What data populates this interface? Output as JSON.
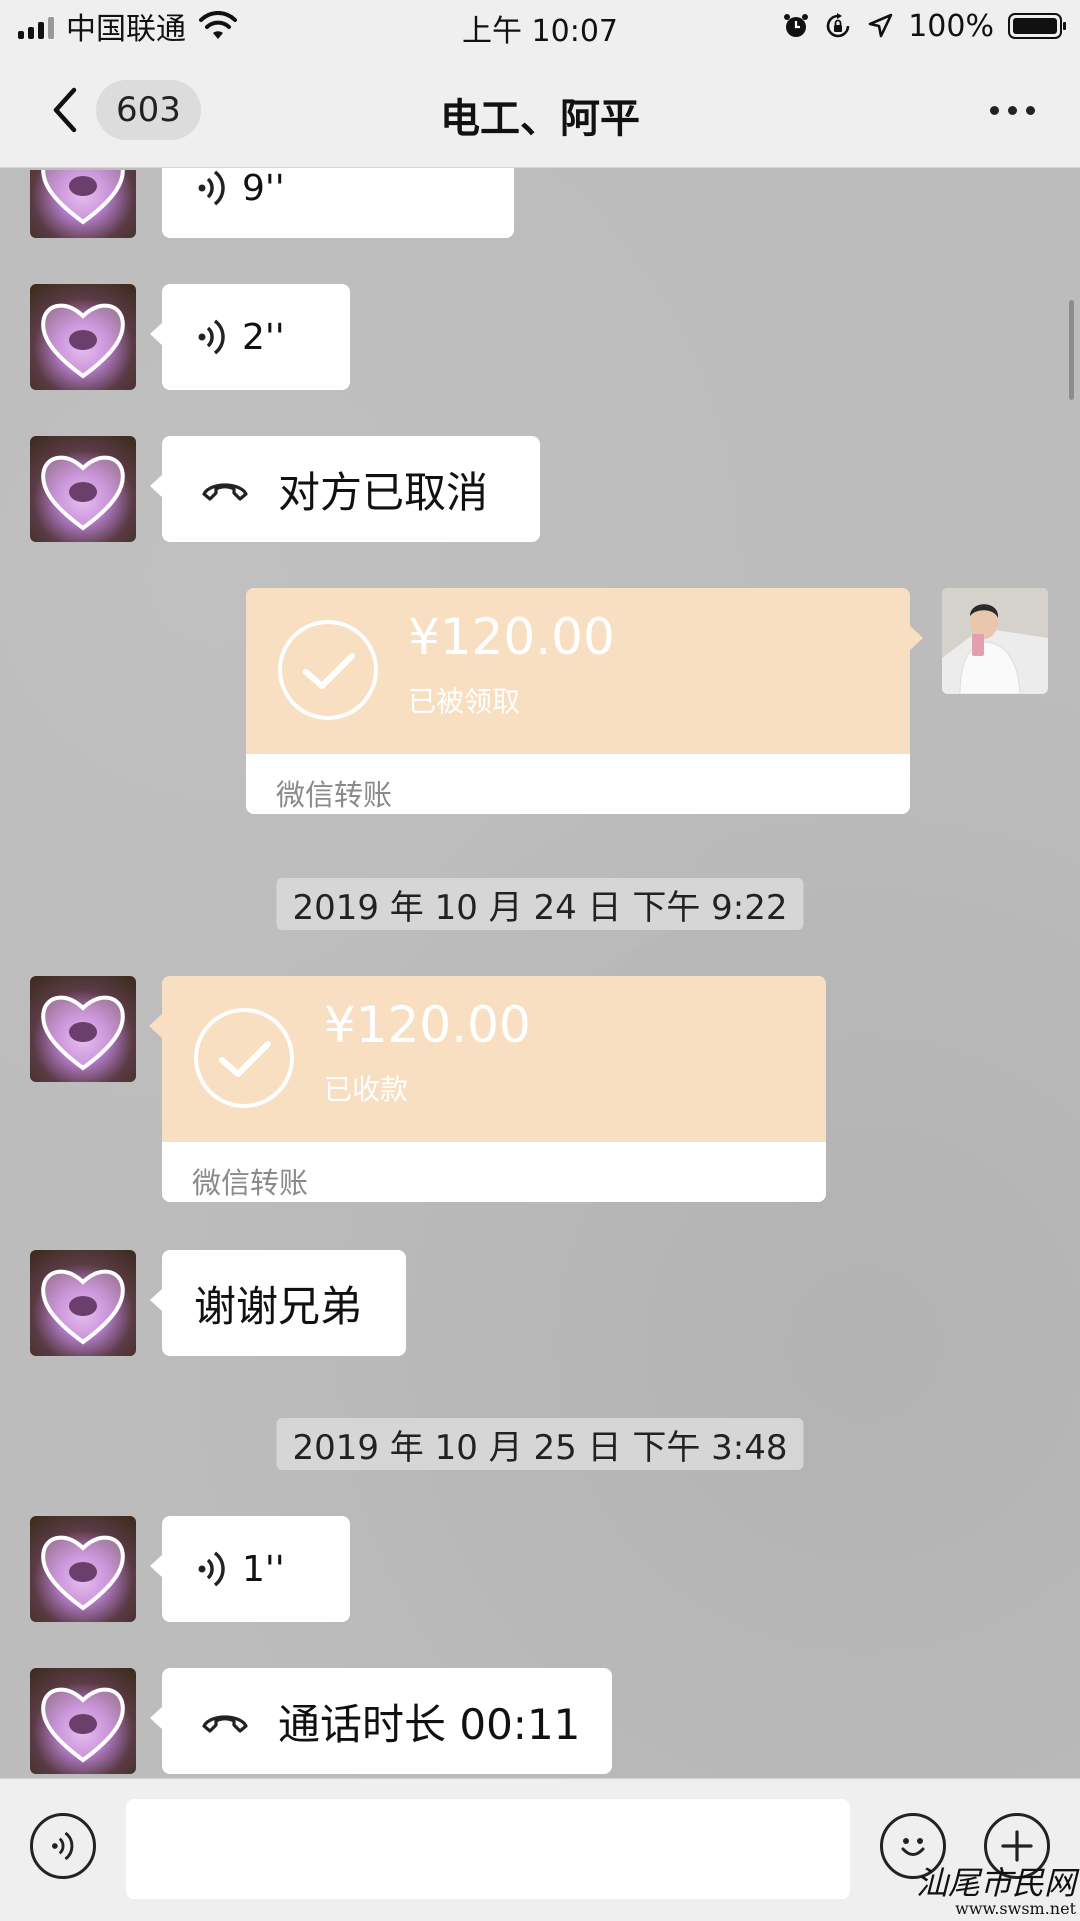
{
  "status_bar": {
    "carrier": "中国联通",
    "time": "上午 10:07",
    "battery": "100%",
    "icons": [
      "signal-icon",
      "wifi-icon",
      "alarm-icon",
      "orientation-lock-icon",
      "location-icon",
      "battery-icon"
    ]
  },
  "nav": {
    "back_icon": "chevron-left-icon",
    "unread_count": "603",
    "title": "电工、阿平",
    "more_icon": "more-dots-icon"
  },
  "messages": [
    {
      "type": "voice",
      "side": "left",
      "duration": "9''"
    },
    {
      "type": "voice",
      "side": "left",
      "duration": "2''"
    },
    {
      "type": "call",
      "side": "left",
      "text": "对方已取消"
    },
    {
      "type": "transfer",
      "side": "right",
      "amount": "¥120.00",
      "status": "已被领取",
      "footer": "微信转账"
    },
    {
      "type": "timestamp",
      "text": "2019 年 10 月 24 日 下午 9:22"
    },
    {
      "type": "transfer",
      "side": "left",
      "amount": "¥120.00",
      "status": "已收款",
      "footer": "微信转账"
    },
    {
      "type": "text",
      "side": "left",
      "text": "谢谢兄弟"
    },
    {
      "type": "timestamp",
      "text": "2019 年 10 月 25 日 下午 3:48"
    },
    {
      "type": "voice",
      "side": "left",
      "duration": "1''"
    },
    {
      "type": "call",
      "side": "left",
      "text": "通话时长 00:11"
    }
  ],
  "input_bar": {
    "voice_icon": "voice-input-icon",
    "input_value": "",
    "emoji_icon": "emoji-icon",
    "plus_icon": "plus-icon"
  },
  "watermark": {
    "title": "汕尾市民网",
    "url": "www.swsm.net"
  },
  "colors": {
    "chat_bg": "#bcbcbc",
    "bubble": "#ffffff",
    "transfer_top": "#f8dfc1",
    "nav_bg": "#efefef"
  }
}
